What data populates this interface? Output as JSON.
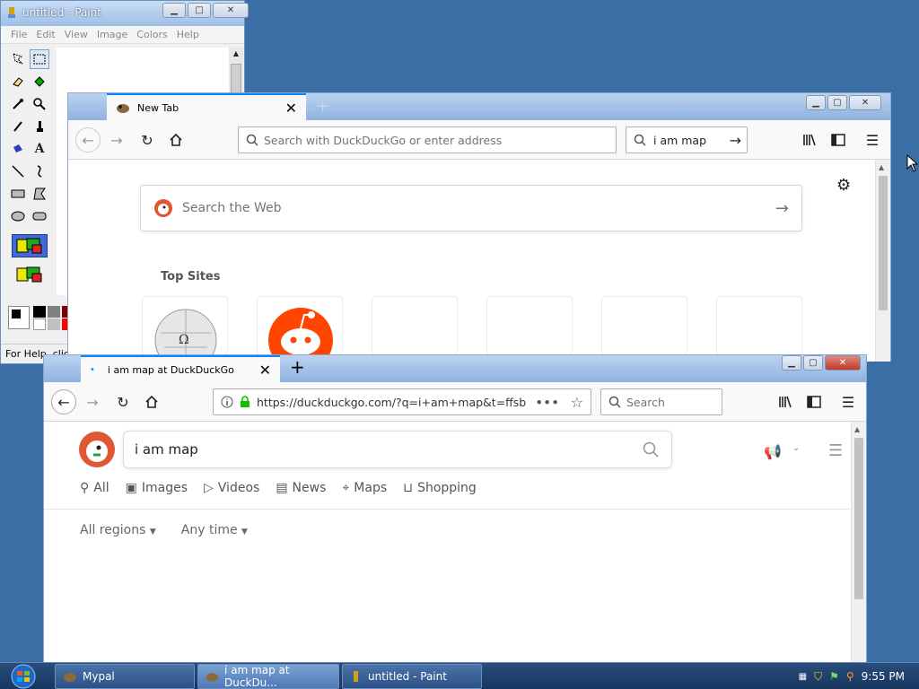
{
  "paint": {
    "title": "untitled - Paint",
    "menu": [
      "File",
      "Edit",
      "View",
      "Image",
      "Colors",
      "Help"
    ],
    "status": "For Help, click Help Topics on the Help Menu."
  },
  "browser_back": {
    "tab_title": "New Tab",
    "address_placeholder": "Search with DuckDuckGo or enter address",
    "search_value": "i am map",
    "page_search_placeholder": "Search the Web",
    "top_sites_label": "Top Sites"
  },
  "browser_front": {
    "tab_title": "i am map at DuckDuckGo",
    "url": "https://duckduckgo.com/?q=i+am+map&t=ffsb",
    "search_placeholder": "Search",
    "query": "i am map",
    "tabs": [
      "All",
      "Images",
      "Videos",
      "News",
      "Maps",
      "Shopping"
    ],
    "filters": [
      "All regions",
      "Any time"
    ]
  },
  "taskbar": {
    "items": [
      "Mypal",
      "i am map at DuckDu...",
      "untitled - Paint"
    ],
    "clock": "9:55 PM"
  },
  "colors": {
    "desktop": "#3a6ea5",
    "ddg_orange": "#de5833",
    "reddit_orange": "#ff4500",
    "accent_blue": "#0a84ff"
  }
}
